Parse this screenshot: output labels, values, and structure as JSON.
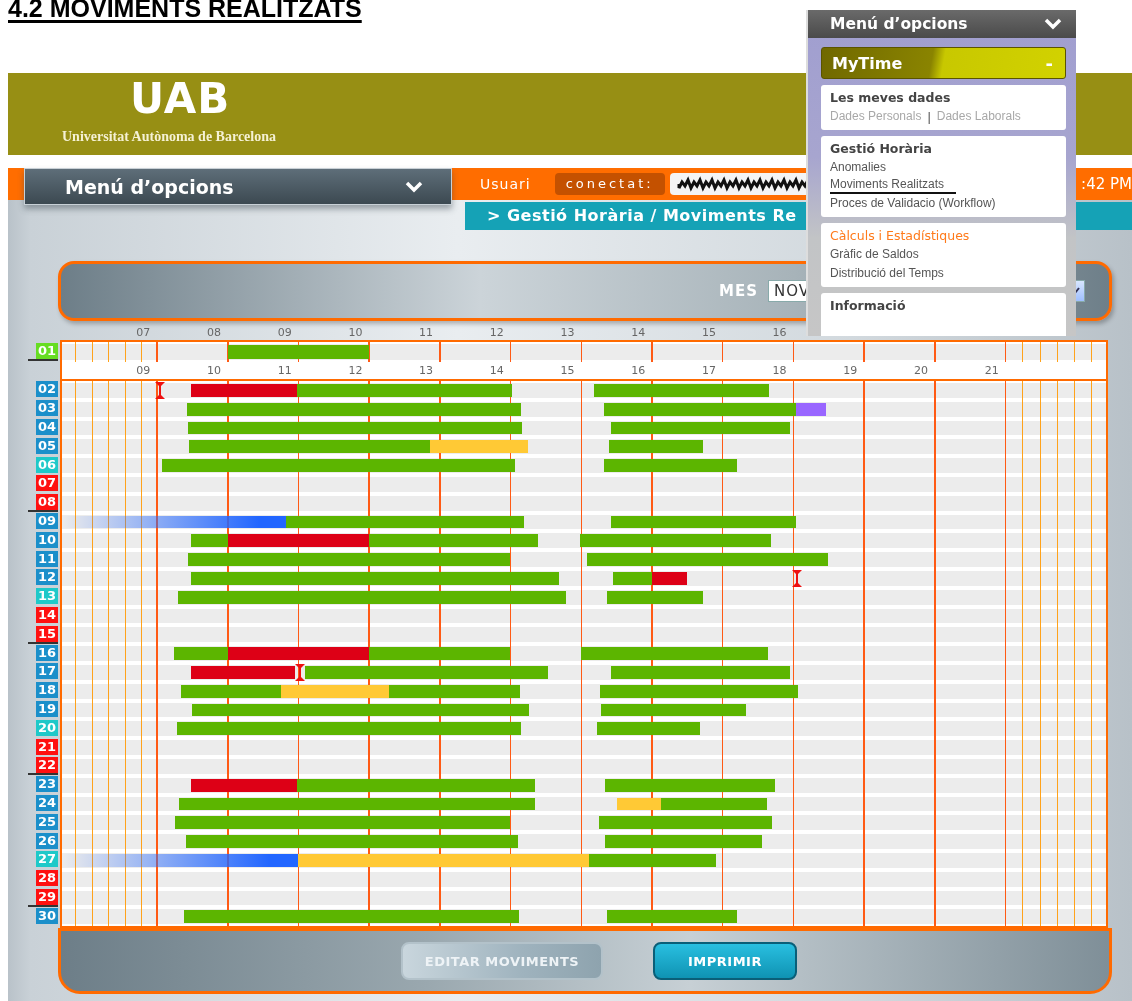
{
  "heading": "4.2 MOVIMENTS REALITZATS",
  "banner": {
    "logo": "UAB",
    "subtitle": "Universitat Autònoma de Barcelona"
  },
  "topbar": {
    "menu_button": "Menú d’opcions",
    "user_label": "Usuari",
    "connected_label": "conectat:",
    "user_field": {
      "redacted": true
    },
    "time": ":42 PM"
  },
  "breadcrumb": "> Gestió Horària / Moviments Re",
  "filter": {
    "label": "MES",
    "month": "NOV"
  },
  "timeline": {
    "upper_axis": [
      "07",
      "08",
      "09",
      "10",
      "11",
      "12",
      "13",
      "14",
      "15",
      "16"
    ],
    "lower_axis": [
      "09",
      "10",
      "11",
      "12",
      "13",
      "14",
      "15",
      "16",
      "17",
      "18",
      "19",
      "20",
      "21"
    ],
    "rows": [
      {
        "day": "01",
        "color": "#66dd22",
        "divider_after": true,
        "segments": [
          {
            "kind": "bar",
            "color": "#5cb500"
          }
        ]
      },
      {
        "day": "02",
        "color": "#1b8fca",
        "divider_after": false,
        "segments": [
          {
            "kind": "marker",
            "color": "#ee1111"
          },
          {
            "kind": "bar",
            "color": "#dd0016"
          },
          {
            "kind": "bar",
            "color": "#5cb500"
          },
          {
            "kind": "bar",
            "color": "#5cb500"
          }
        ]
      },
      {
        "day": "03",
        "color": "#1b8fca",
        "divider_after": false,
        "segments": [
          {
            "kind": "bar",
            "color": "#5cb500"
          },
          {
            "kind": "bar",
            "color": "#5cb500"
          },
          {
            "kind": "bar",
            "color": "#9966ff"
          }
        ]
      },
      {
        "day": "04",
        "color": "#1b8fca",
        "divider_after": false,
        "segments": [
          {
            "kind": "bar",
            "color": "#5cb500"
          },
          {
            "kind": "bar",
            "color": "#5cb500"
          }
        ]
      },
      {
        "day": "05",
        "color": "#1b8fca",
        "divider_after": false,
        "segments": [
          {
            "kind": "bar",
            "color": "#5cb500"
          },
          {
            "kind": "bar",
            "color": "#ffc935"
          },
          {
            "kind": "bar",
            "color": "#5cb500"
          }
        ]
      },
      {
        "day": "06",
        "color": "#1ec9c9",
        "divider_after": false,
        "segments": [
          {
            "kind": "bar",
            "color": "#5cb500"
          },
          {
            "kind": "bar",
            "color": "#5cb500"
          }
        ]
      },
      {
        "day": "07",
        "color": "#ff1010",
        "divider_after": false
      },
      {
        "day": "08",
        "color": "#ff1010",
        "divider_after": true
      },
      {
        "day": "09",
        "color": "#1b8fca",
        "divider_after": false,
        "segments": [
          {
            "kind": "fade",
            "color": "#2266ff"
          },
          {
            "kind": "bar",
            "color": "#5cb500"
          },
          {
            "kind": "bar",
            "color": "#5cb500"
          }
        ]
      },
      {
        "day": "10",
        "color": "#1b8fca",
        "divider_after": false,
        "segments": [
          {
            "kind": "bar",
            "color": "#5cb500"
          },
          {
            "kind": "bar",
            "color": "#dd0016"
          },
          {
            "kind": "bar",
            "color": "#5cb500"
          },
          {
            "kind": "bar",
            "color": "#5cb500"
          }
        ]
      },
      {
        "day": "11",
        "color": "#1b8fca",
        "divider_after": false,
        "segments": [
          {
            "kind": "bar",
            "color": "#5cb500"
          },
          {
            "kind": "bar",
            "color": "#5cb500"
          }
        ]
      },
      {
        "day": "12",
        "color": "#1b8fca",
        "divider_after": false,
        "segments": [
          {
            "kind": "bar",
            "color": "#5cb500"
          },
          {
            "kind": "bar",
            "color": "#5cb500"
          },
          {
            "kind": "bar",
            "color": "#dd0016"
          },
          {
            "kind": "marker",
            "color": "#ee1111"
          }
        ]
      },
      {
        "day": "13",
        "color": "#1ec9c9",
        "divider_after": false,
        "segments": [
          {
            "kind": "bar",
            "color": "#5cb500"
          },
          {
            "kind": "bar",
            "color": "#5cb500"
          }
        ]
      },
      {
        "day": "14",
        "color": "#ff1010",
        "divider_after": false
      },
      {
        "day": "15",
        "color": "#ff1010",
        "divider_after": true
      },
      {
        "day": "16",
        "color": "#1b8fca",
        "divider_after": false,
        "segments": [
          {
            "kind": "bar",
            "color": "#5cb500"
          },
          {
            "kind": "bar",
            "color": "#dd0016"
          },
          {
            "kind": "bar",
            "color": "#5cb500"
          },
          {
            "kind": "bar",
            "color": "#5cb500"
          }
        ]
      },
      {
        "day": "17",
        "color": "#1b8fca",
        "divider_after": false,
        "segments": [
          {
            "kind": "bar",
            "color": "#dd0016"
          },
          {
            "kind": "marker",
            "color": "#ee1111"
          },
          {
            "kind": "bar",
            "color": "#5cb500"
          },
          {
            "kind": "bar",
            "color": "#5cb500"
          }
        ]
      },
      {
        "day": "18",
        "color": "#1b8fca",
        "divider_after": false,
        "segments": [
          {
            "kind": "bar",
            "color": "#5cb500"
          },
          {
            "kind": "bar",
            "color": "#ffc935"
          },
          {
            "kind": "bar",
            "color": "#5cb500"
          },
          {
            "kind": "bar",
            "color": "#5cb500"
          }
        ]
      },
      {
        "day": "19",
        "color": "#1b8fca",
        "divider_after": false,
        "segments": [
          {
            "kind": "bar",
            "color": "#5cb500"
          },
          {
            "kind": "bar",
            "color": "#5cb500"
          }
        ]
      },
      {
        "day": "20",
        "color": "#1ec9c9",
        "divider_after": false,
        "segments": [
          {
            "kind": "bar",
            "color": "#5cb500"
          },
          {
            "kind": "bar",
            "color": "#5cb500"
          }
        ]
      },
      {
        "day": "21",
        "color": "#ff1010",
        "divider_after": false
      },
      {
        "day": "22",
        "color": "#ff1010",
        "divider_after": true
      },
      {
        "day": "23",
        "color": "#1b8fca",
        "divider_after": false,
        "segments": [
          {
            "kind": "bar",
            "color": "#dd0016"
          },
          {
            "kind": "bar",
            "color": "#5cb500"
          },
          {
            "kind": "bar",
            "color": "#5cb500"
          }
        ]
      },
      {
        "day": "24",
        "color": "#1b8fca",
        "divider_after": false,
        "segments": [
          {
            "kind": "bar",
            "color": "#5cb500"
          },
          {
            "kind": "bar",
            "color": "#ffc935"
          },
          {
            "kind": "bar",
            "color": "#5cb500"
          }
        ]
      },
      {
        "day": "25",
        "color": "#1b8fca",
        "divider_after": false,
        "segments": [
          {
            "kind": "bar",
            "color": "#5cb500"
          },
          {
            "kind": "bar",
            "color": "#5cb500"
          }
        ]
      },
      {
        "day": "26",
        "color": "#1b8fca",
        "divider_after": false,
        "segments": [
          {
            "kind": "bar",
            "color": "#5cb500"
          },
          {
            "kind": "bar",
            "color": "#5cb500"
          }
        ]
      },
      {
        "day": "27",
        "color": "#1ec9c9",
        "divider_after": false,
        "segments": [
          {
            "kind": "fade",
            "color": "#2266ff"
          },
          {
            "kind": "bar",
            "color": "#ffc935"
          },
          {
            "kind": "bar",
            "color": "#5cb500"
          }
        ]
      },
      {
        "day": "28",
        "color": "#ff1010",
        "divider_after": false
      },
      {
        "day": "29",
        "color": "#ff1010",
        "divider_after": true
      },
      {
        "day": "30",
        "color": "#1b8fca",
        "divider_after": false,
        "segments": [
          {
            "kind": "bar",
            "color": "#5cb500"
          },
          {
            "kind": "bar",
            "color": "#5cb500"
          }
        ]
      }
    ]
  },
  "footer": {
    "buttons": [
      {
        "label": "EDITAR MOVIMENTS",
        "disabled": true
      },
      {
        "label": "IMPRIMIR",
        "disabled": false
      }
    ]
  },
  "options_menu": {
    "title": "Menú d’opcions",
    "section": {
      "title": "MyTime",
      "toggle": "-",
      "expanded": true
    },
    "cards": [
      {
        "title": "Les meves dades",
        "highlighted": false,
        "separator": "|",
        "items": [
          {
            "label": "Dades Personals",
            "disabled": true,
            "annotated": false
          },
          {
            "label": "Dades Laborals",
            "disabled": true,
            "annotated": false
          }
        ]
      },
      {
        "title": "Gestió Horària",
        "highlighted": false,
        "items": [
          {
            "label": "Anomalies",
            "disabled": false,
            "annotated": false
          },
          {
            "label": "Moviments Realitzats",
            "disabled": false,
            "annotated": true
          },
          {
            "label": "Proces de Validacio (Workflow)",
            "disabled": false,
            "annotated": false
          }
        ]
      },
      {
        "title": "Càlculs i Estadístiques",
        "highlighted": true,
        "items": [
          {
            "label": "Gràfic de Saldos",
            "disabled": false,
            "annotated": false
          },
          {
            "label": "Distribució del Temps",
            "disabled": false,
            "annotated": false
          }
        ]
      },
      {
        "title": "Informació",
        "highlighted": false
      }
    ]
  }
}
